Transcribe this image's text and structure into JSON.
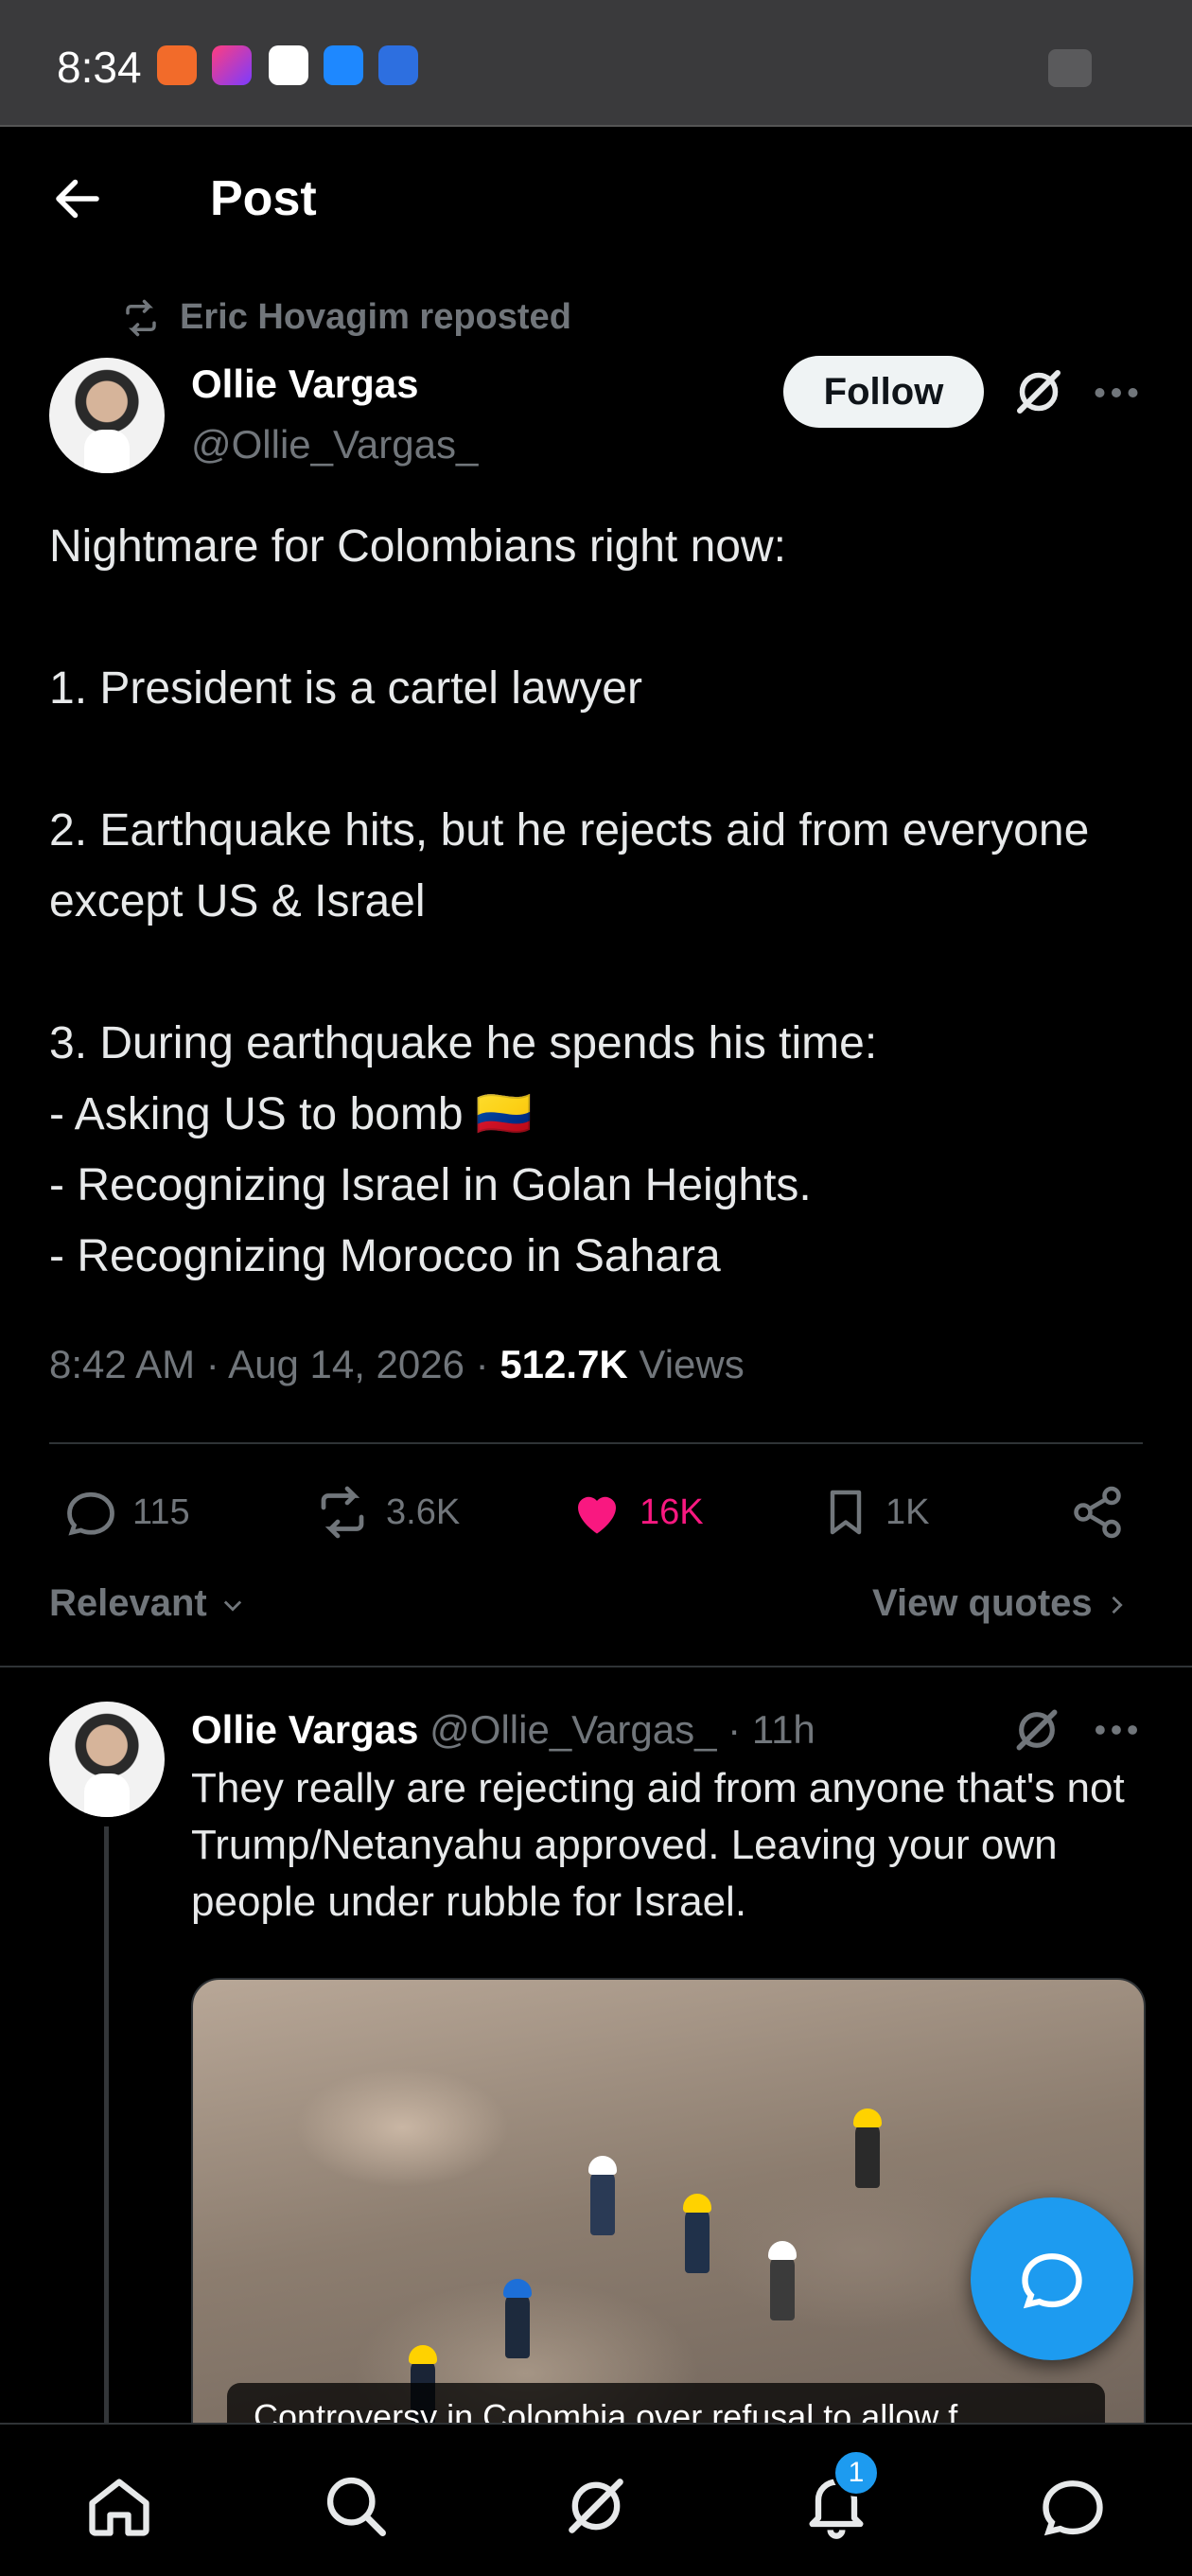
{
  "status_bar": {
    "time": "8:34"
  },
  "header": {
    "title": "Post"
  },
  "post": {
    "repost_text": "Eric Hovagim reposted",
    "author_name": "Ollie Vargas",
    "author_handle": "@Ollie_Vargas_",
    "follow_label": "Follow",
    "text": "Nightmare for Colombians right now:\n\n1. President is a cartel lawyer\n\n2. Earthquake hits, but he rejects aid from everyone except US & Israel\n\n3. During earthquake he spends his time:\n- Asking US to bomb 🇨🇴\n- Recognizing Israel in Golan Heights.\n- Recognizing Morocco in Sahara",
    "timestamp": "8:42 AM · Aug 14, 2026 · ",
    "views_count": "512.7K",
    "views_label": " Views",
    "actions": {
      "replies": "115",
      "reposts": "3.6K",
      "likes": "16K",
      "bookmarks": "1K"
    }
  },
  "sort": {
    "relevant_label": "Relevant",
    "view_quotes_label": "View quotes"
  },
  "reply": {
    "author_name": "Ollie Vargas",
    "author_handle": "@Ollie_Vargas_",
    "time": " · 11h",
    "text": "They really are rejecting aid from anyone that's not Trump/Netanyahu approved. Leaving your own people under rubble for Israel.",
    "media_caption": "Controversy in Colombia over refusal to allow f..."
  },
  "bottom_nav": {
    "notification_count": "1"
  },
  "colors": {
    "accent": "#1d9bf0",
    "like": "#f91880",
    "background": "#000000"
  }
}
